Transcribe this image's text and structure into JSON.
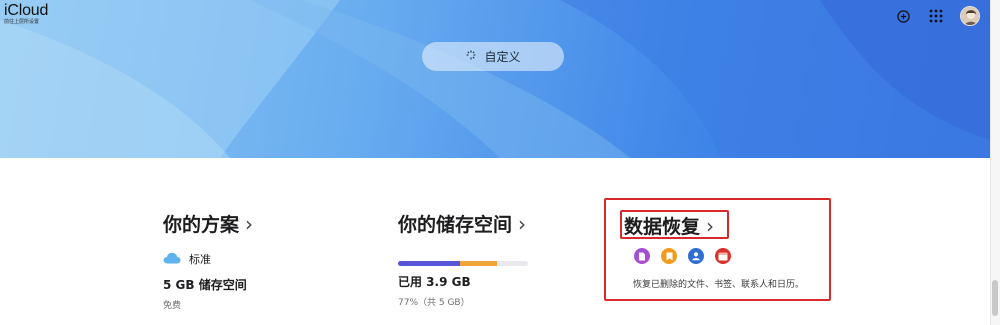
{
  "brand": {
    "title": "iCloud",
    "subtitle": "前往上层所设置"
  },
  "topbar": {
    "add_icon": "plus-circle-icon",
    "apps_icon": "grid-icon",
    "avatar_icon": "avatar"
  },
  "hero": {
    "customize_label": "自定义",
    "customize_icon": "sparkle-icon"
  },
  "plan": {
    "title": "你的方案",
    "tier": "标准",
    "tier_icon": "cloud-icon",
    "storage": "5 GB 储存空间",
    "price": "免费"
  },
  "storage": {
    "title": "你的储存空间",
    "used_label": "已用 3.9 GB",
    "used_detail": "77%（共 5 GB）",
    "usage_fraction": 0.77,
    "segments": [
      {
        "name": "primary",
        "fraction": 0.48,
        "color": "#5856d6"
      },
      {
        "name": "secondary",
        "fraction": 0.28,
        "color": "#f0a53a"
      }
    ]
  },
  "recovery": {
    "title": "数据恢复",
    "icons": [
      {
        "name": "files-icon",
        "color": "#a550d0"
      },
      {
        "name": "bookmarks-icon",
        "color": "#f39a1c"
      },
      {
        "name": "contacts-icon",
        "color": "#2f6fd3"
      },
      {
        "name": "calendar-icon",
        "color": "#d9322d"
      }
    ],
    "description": "恢复已删除的文件、书签、联系人和日历。"
  },
  "colors": {
    "highlight_box": "#d82a2a",
    "hero_start": "#8ec7f2",
    "hero_end": "#3a73e0"
  }
}
